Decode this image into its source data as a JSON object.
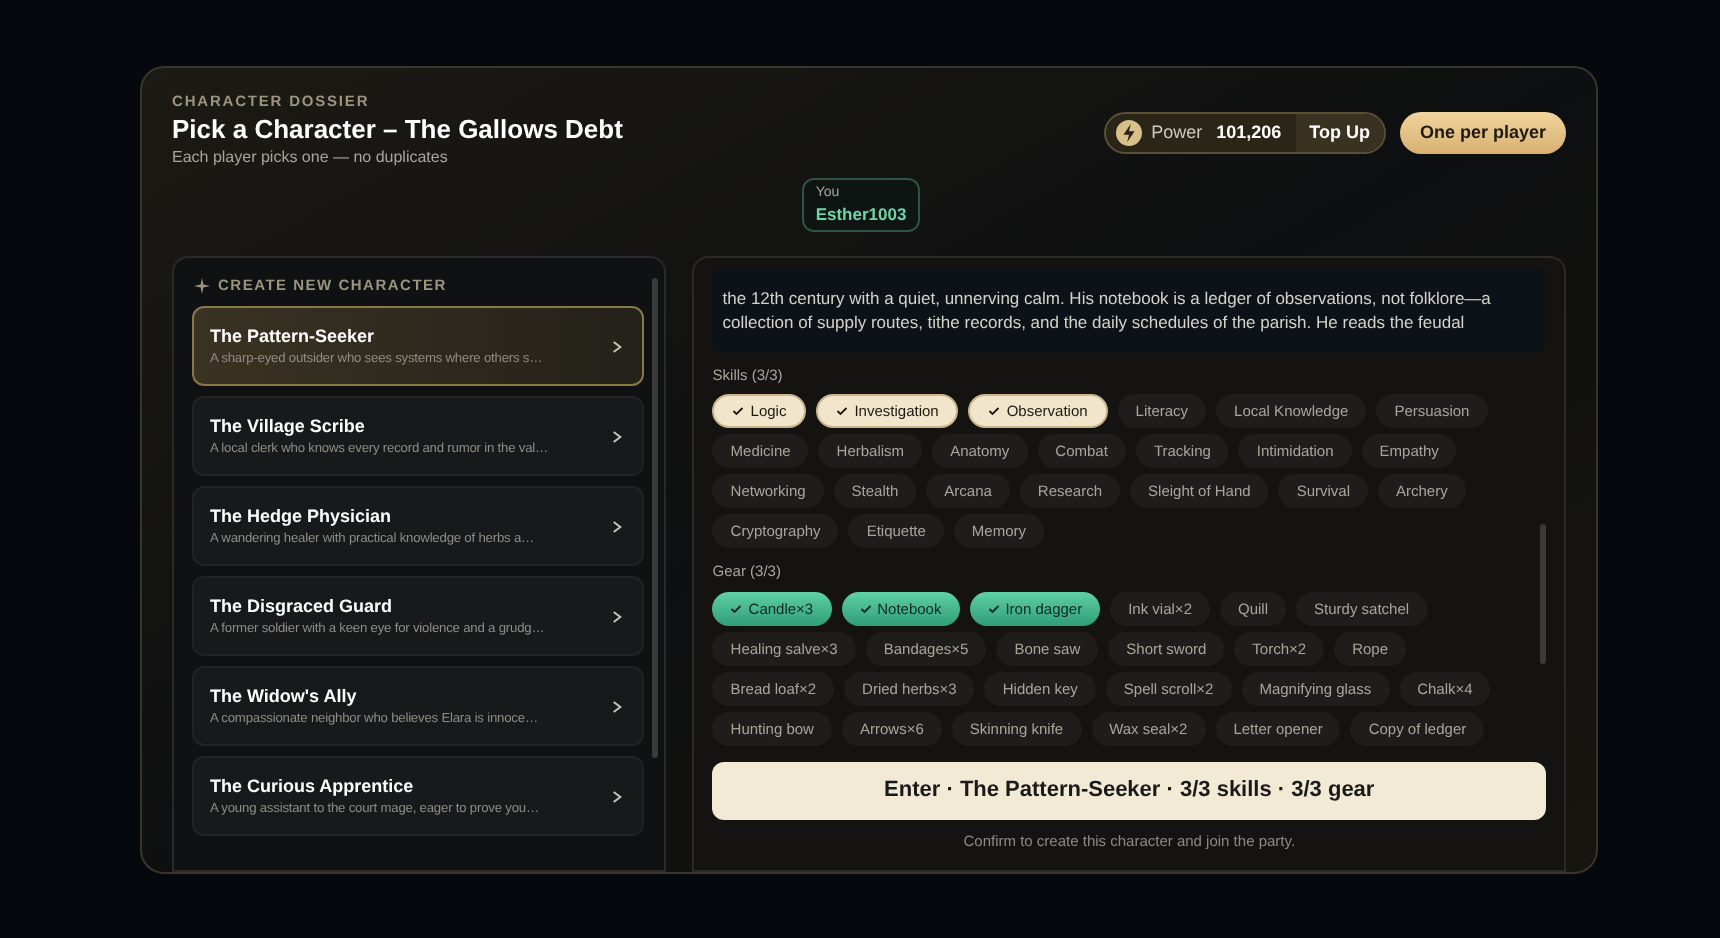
{
  "header": {
    "eyebrow": "CHARACTER DOSSIER",
    "title": "Pick a Character – The Gallows Debt",
    "subtitle": "Each player picks one — no duplicates"
  },
  "power": {
    "label": "Power",
    "value": "101,206",
    "action": "Top Up"
  },
  "rule_button": "One per player",
  "player": {
    "label": "You",
    "name": "Esther1003"
  },
  "create_heading": "CREATE NEW CHARACTER",
  "characters": [
    {
      "title": "The Pattern-Seeker",
      "description": "A sharp-eyed outsider who sees systems where others s…",
      "selected": true
    },
    {
      "title": "The Village Scribe",
      "description": "A local clerk who knows every record and rumor in the val…",
      "selected": false
    },
    {
      "title": "The Hedge Physician",
      "description": "A wandering healer with practical knowledge of herbs a…",
      "selected": false
    },
    {
      "title": "The Disgraced Guard",
      "description": "A former soldier with a keen eye for violence and a grudg…",
      "selected": false
    },
    {
      "title": "The Widow's Ally",
      "description": "A compassionate neighbor who believes Elara is innoce…",
      "selected": false
    },
    {
      "title": "The Curious Apprentice",
      "description": "A young assistant to the court mage, eager to prove you…",
      "selected": false
    }
  ],
  "biography": "the 12th century with a quiet, unnerving calm. His notebook is a ledger of observations, not folklore—a collection of supply routes, tithe records, and the daily schedules of the parish. He reads the feudal",
  "skills": {
    "label": "Skills (3/3)",
    "chips": [
      {
        "label": "Logic",
        "selected": true
      },
      {
        "label": "Investigation",
        "selected": true
      },
      {
        "label": "Observation",
        "selected": true
      },
      {
        "label": "Literacy",
        "selected": false
      },
      {
        "label": "Local Knowledge",
        "selected": false
      },
      {
        "label": "Persuasion",
        "selected": false
      },
      {
        "label": "Medicine",
        "selected": false
      },
      {
        "label": "Herbalism",
        "selected": false
      },
      {
        "label": "Anatomy",
        "selected": false
      },
      {
        "label": "Combat",
        "selected": false
      },
      {
        "label": "Tracking",
        "selected": false
      },
      {
        "label": "Intimidation",
        "selected": false
      },
      {
        "label": "Empathy",
        "selected": false
      },
      {
        "label": "Networking",
        "selected": false
      },
      {
        "label": "Stealth",
        "selected": false
      },
      {
        "label": "Arcana",
        "selected": false
      },
      {
        "label": "Research",
        "selected": false
      },
      {
        "label": "Sleight of Hand",
        "selected": false
      },
      {
        "label": "Survival",
        "selected": false
      },
      {
        "label": "Archery",
        "selected": false
      },
      {
        "label": "Cryptography",
        "selected": false
      },
      {
        "label": "Etiquette",
        "selected": false
      },
      {
        "label": "Memory",
        "selected": false
      }
    ]
  },
  "gear": {
    "label": "Gear (3/3)",
    "chips": [
      {
        "label": "Candle×3",
        "selected": true
      },
      {
        "label": "Notebook",
        "selected": true
      },
      {
        "label": "Iron dagger",
        "selected": true
      },
      {
        "label": "Ink vial×2",
        "selected": false
      },
      {
        "label": "Quill",
        "selected": false
      },
      {
        "label": "Sturdy satchel",
        "selected": false
      },
      {
        "label": "Healing salve×3",
        "selected": false
      },
      {
        "label": "Bandages×5",
        "selected": false
      },
      {
        "label": "Bone saw",
        "selected": false
      },
      {
        "label": "Short sword",
        "selected": false
      },
      {
        "label": "Torch×2",
        "selected": false
      },
      {
        "label": "Rope",
        "selected": false
      },
      {
        "label": "Bread loaf×2",
        "selected": false
      },
      {
        "label": "Dried herbs×3",
        "selected": false
      },
      {
        "label": "Hidden key",
        "selected": false
      },
      {
        "label": "Spell scroll×2",
        "selected": false
      },
      {
        "label": "Magnifying glass",
        "selected": false
      },
      {
        "label": "Chalk×4",
        "selected": false
      },
      {
        "label": "Hunting bow",
        "selected": false
      },
      {
        "label": "Arrows×6",
        "selected": false
      },
      {
        "label": "Skinning knife",
        "selected": false
      },
      {
        "label": "Wax seal×2",
        "selected": false
      },
      {
        "label": "Letter opener",
        "selected": false
      },
      {
        "label": "Copy of ledger",
        "selected": false
      }
    ]
  },
  "enter_button": "Enter · The Pattern-Seeker · 3/3 skills · 3/3 gear",
  "confirm_note": "Confirm to create this character and join the party."
}
